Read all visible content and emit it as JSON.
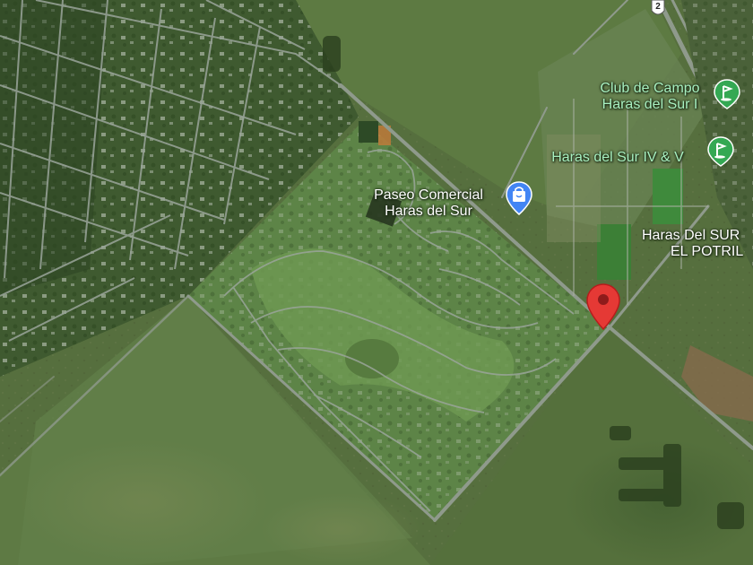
{
  "map": {
    "view": "satellite",
    "labels": {
      "club_line1": "Club de Campo",
      "club_line2": "Haras del Sur I",
      "haras_iv_v": "Haras del Sur IV & V",
      "paseo_line1": "Paseo Comercial",
      "paseo_line2": "Haras del Sur",
      "haras_potril_line1": "Haras Del SUR",
      "haras_potril_line2": "EL POTRIL"
    },
    "route_shield": "2",
    "icons": {
      "golf": "golf-icon",
      "shopping": "shopping-bag-icon",
      "pin": "location-pin-icon"
    },
    "colors": {
      "pin": "#e53935",
      "golf_badge": "#34a853",
      "shop_badge": "#4285f4",
      "poi_text_green": "#a8f0c0"
    }
  }
}
